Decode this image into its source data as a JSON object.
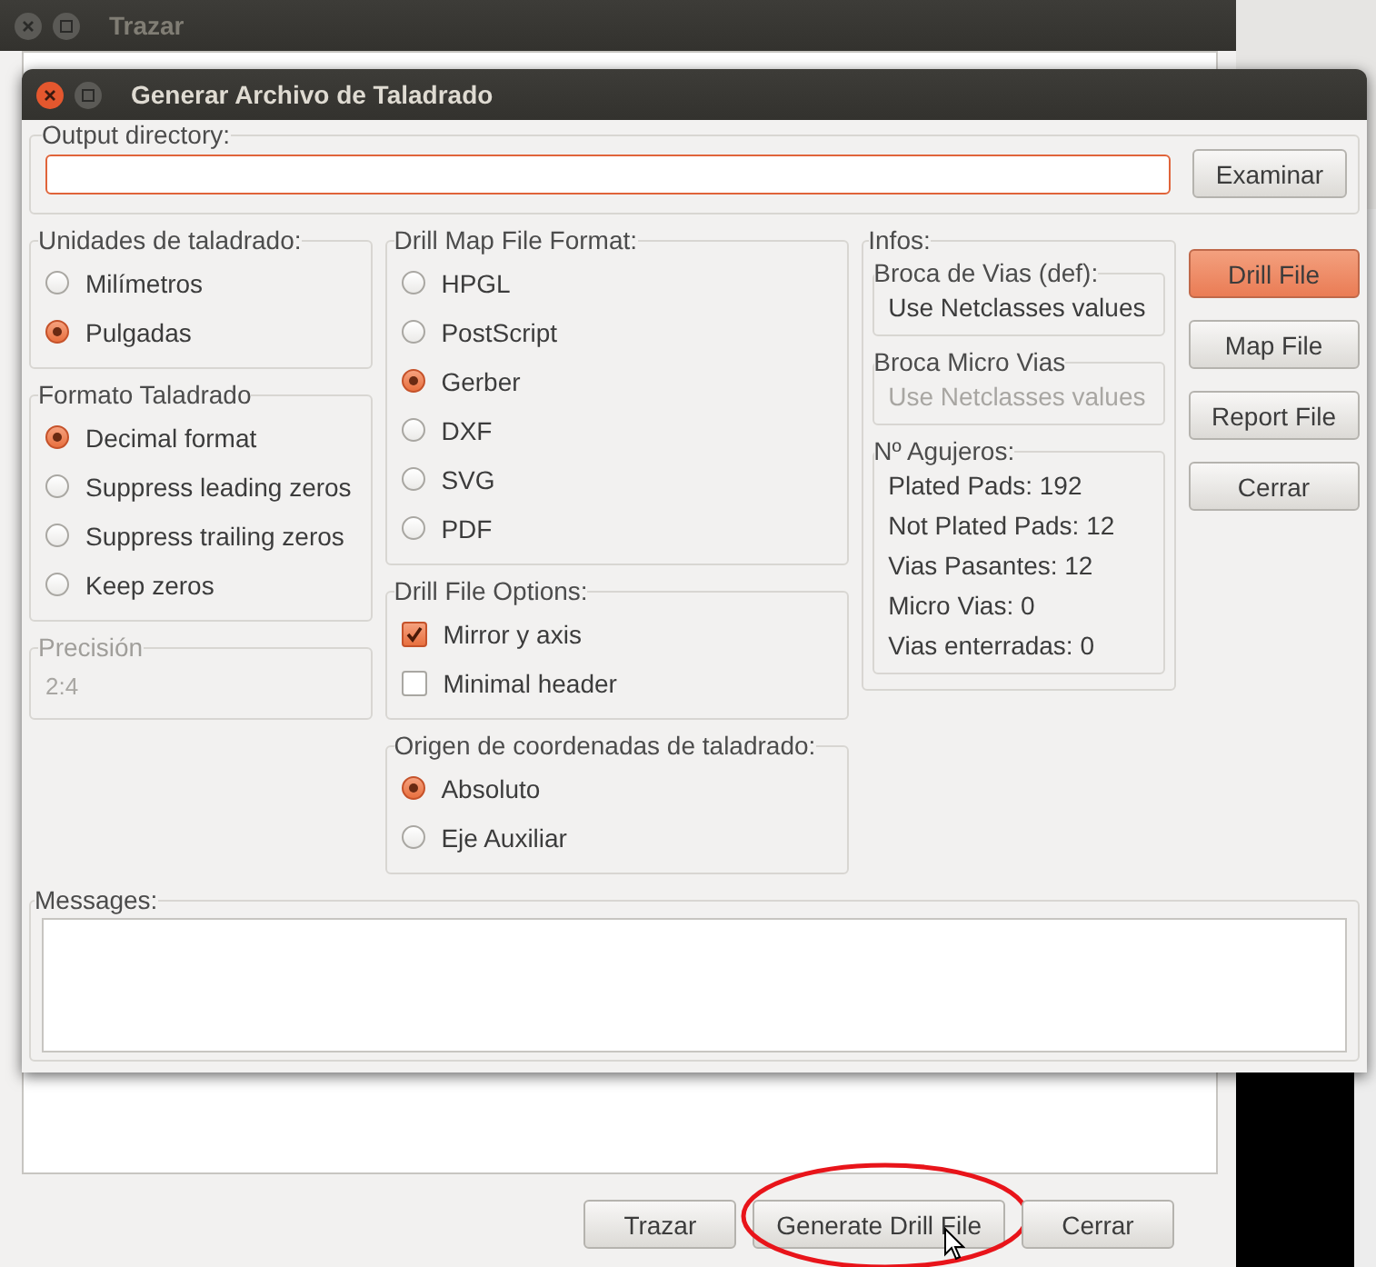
{
  "background_window": {
    "title": "Trazar",
    "buttons": [
      {
        "label": "Trazar",
        "circled": false
      },
      {
        "label": "Generate Drill File",
        "circled": true
      },
      {
        "label": "Cerrar",
        "circled": false
      }
    ]
  },
  "dialog": {
    "title": "Generar Archivo de Taladrado",
    "output_directory": {
      "label": "Output directory:",
      "button": "Examinar"
    },
    "units": {
      "label": "Unidades de taladrado:",
      "options": [
        {
          "label": "Milímetros",
          "selected": false
        },
        {
          "label": "Pulgadas",
          "selected": true
        }
      ]
    },
    "format": {
      "label": "Formato Taladrado",
      "options": [
        {
          "label": "Decimal format",
          "selected": true
        },
        {
          "label": "Suppress leading zeros",
          "selected": false
        },
        {
          "label": "Suppress trailing zeros",
          "selected": false
        },
        {
          "label": "Keep zeros",
          "selected": false
        }
      ]
    },
    "precision": {
      "label": "Precisión",
      "value": "2:4",
      "disabled": true
    },
    "map_format": {
      "label": "Drill Map File Format:",
      "options": [
        {
          "label": "HPGL",
          "selected": false
        },
        {
          "label": "PostScript",
          "selected": false
        },
        {
          "label": "Gerber",
          "selected": true
        },
        {
          "label": "DXF",
          "selected": false
        },
        {
          "label": "SVG",
          "selected": false
        },
        {
          "label": "PDF",
          "selected": false
        }
      ]
    },
    "file_options": {
      "label": "Drill File Options:",
      "options": [
        {
          "label": "Mirror y axis",
          "checked": true
        },
        {
          "label": "Minimal header",
          "checked": false
        }
      ]
    },
    "origin": {
      "label": "Origen de coordenadas de taladrado:",
      "options": [
        {
          "label": "Absoluto",
          "selected": true
        },
        {
          "label": "Eje Auxiliar",
          "selected": false
        }
      ]
    },
    "infos": {
      "label": "Infos:",
      "groups": [
        {
          "label": "Broca de Vias (def):",
          "lines": [
            {
              "text": "Use Netclasses values",
              "disabled": false
            }
          ]
        },
        {
          "label": "Broca Micro Vias",
          "lines": [
            {
              "text": "Use Netclasses values",
              "disabled": true
            }
          ]
        },
        {
          "label": "Nº Agujeros:",
          "lines": [
            {
              "text": "Plated Pads: 192",
              "disabled": false
            },
            {
              "text": "Not Plated Pads: 12",
              "disabled": false
            },
            {
              "text": "Vias Pasantes: 12",
              "disabled": false
            },
            {
              "text": "Micro Vias: 0",
              "disabled": false
            },
            {
              "text": "Vias enterradas: 0",
              "disabled": false
            }
          ]
        }
      ]
    },
    "actions": [
      {
        "label": "Drill File",
        "default": true
      },
      {
        "label": "Map File",
        "default": false
      },
      {
        "label": "Report File",
        "default": false
      },
      {
        "label": "Cerrar",
        "default": false
      }
    ],
    "messages": {
      "label": "Messages:"
    }
  }
}
